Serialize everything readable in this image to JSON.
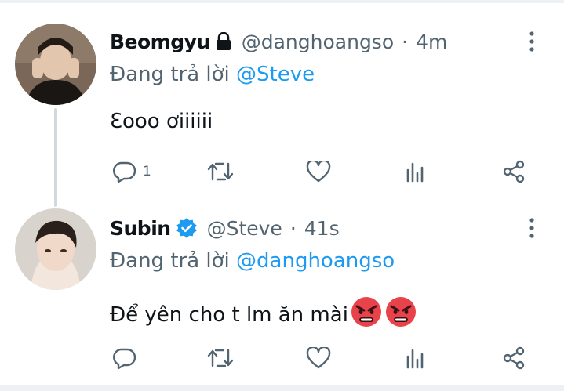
{
  "tweets": [
    {
      "name": "Beomgyu",
      "handle": "@danghoangso",
      "separator": "·",
      "time": "4m",
      "reply_prefix": "Đang trả lời",
      "reply_to": "@Steve",
      "text": "Ɛooo ơiiiiii",
      "reply_count": "1",
      "badge": "lock-icon",
      "avatar_bg": "#6d5a4a"
    },
    {
      "name": "Subin",
      "handle": "@Steve",
      "separator": "·",
      "time": "41s",
      "reply_prefix": "Đang trả lời",
      "reply_to": "@danghoangso",
      "text": "Để yên cho t lm ăn mài",
      "reply_count": "",
      "badge": "verified-icon",
      "emojis": [
        "angry-face-emoji",
        "angry-face-emoji"
      ],
      "avatar_bg": "#cfc9c2"
    }
  ],
  "colors": {
    "text": "#0f1419",
    "secondary": "#536471",
    "accent": "#1d9bf0",
    "thread_line": "#cfd9de"
  }
}
